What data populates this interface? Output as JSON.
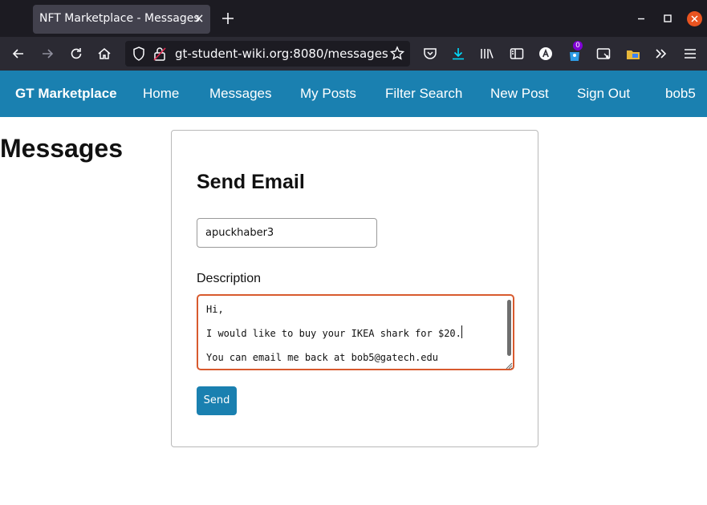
{
  "browser": {
    "tab_title": "NFT Marketplace - Messages",
    "tab_close": "×",
    "url": "gt-student-wiki.org:8080/messages",
    "extension_badge": "0"
  },
  "site": {
    "brand": "GT Marketplace",
    "nav": [
      {
        "label": "Home"
      },
      {
        "label": "Messages"
      },
      {
        "label": "My Posts"
      },
      {
        "label": "Filter Search"
      },
      {
        "label": "New Post"
      },
      {
        "label": "Sign Out"
      },
      {
        "label": "bob5"
      }
    ]
  },
  "page": {
    "title": "Messages",
    "form": {
      "title": "Send Email",
      "recipient_value": "apuckhaber3",
      "description_label": "Description",
      "description_lines": [
        "Hi,",
        "I would like to buy your IKEA shark for $20.",
        "You can email me back at bob5@gatech.edu"
      ],
      "send_label": "Send"
    }
  },
  "colors": {
    "navbar": "#1a80b0",
    "focus_border": "#d85a2e",
    "window_close": "#e95420"
  }
}
